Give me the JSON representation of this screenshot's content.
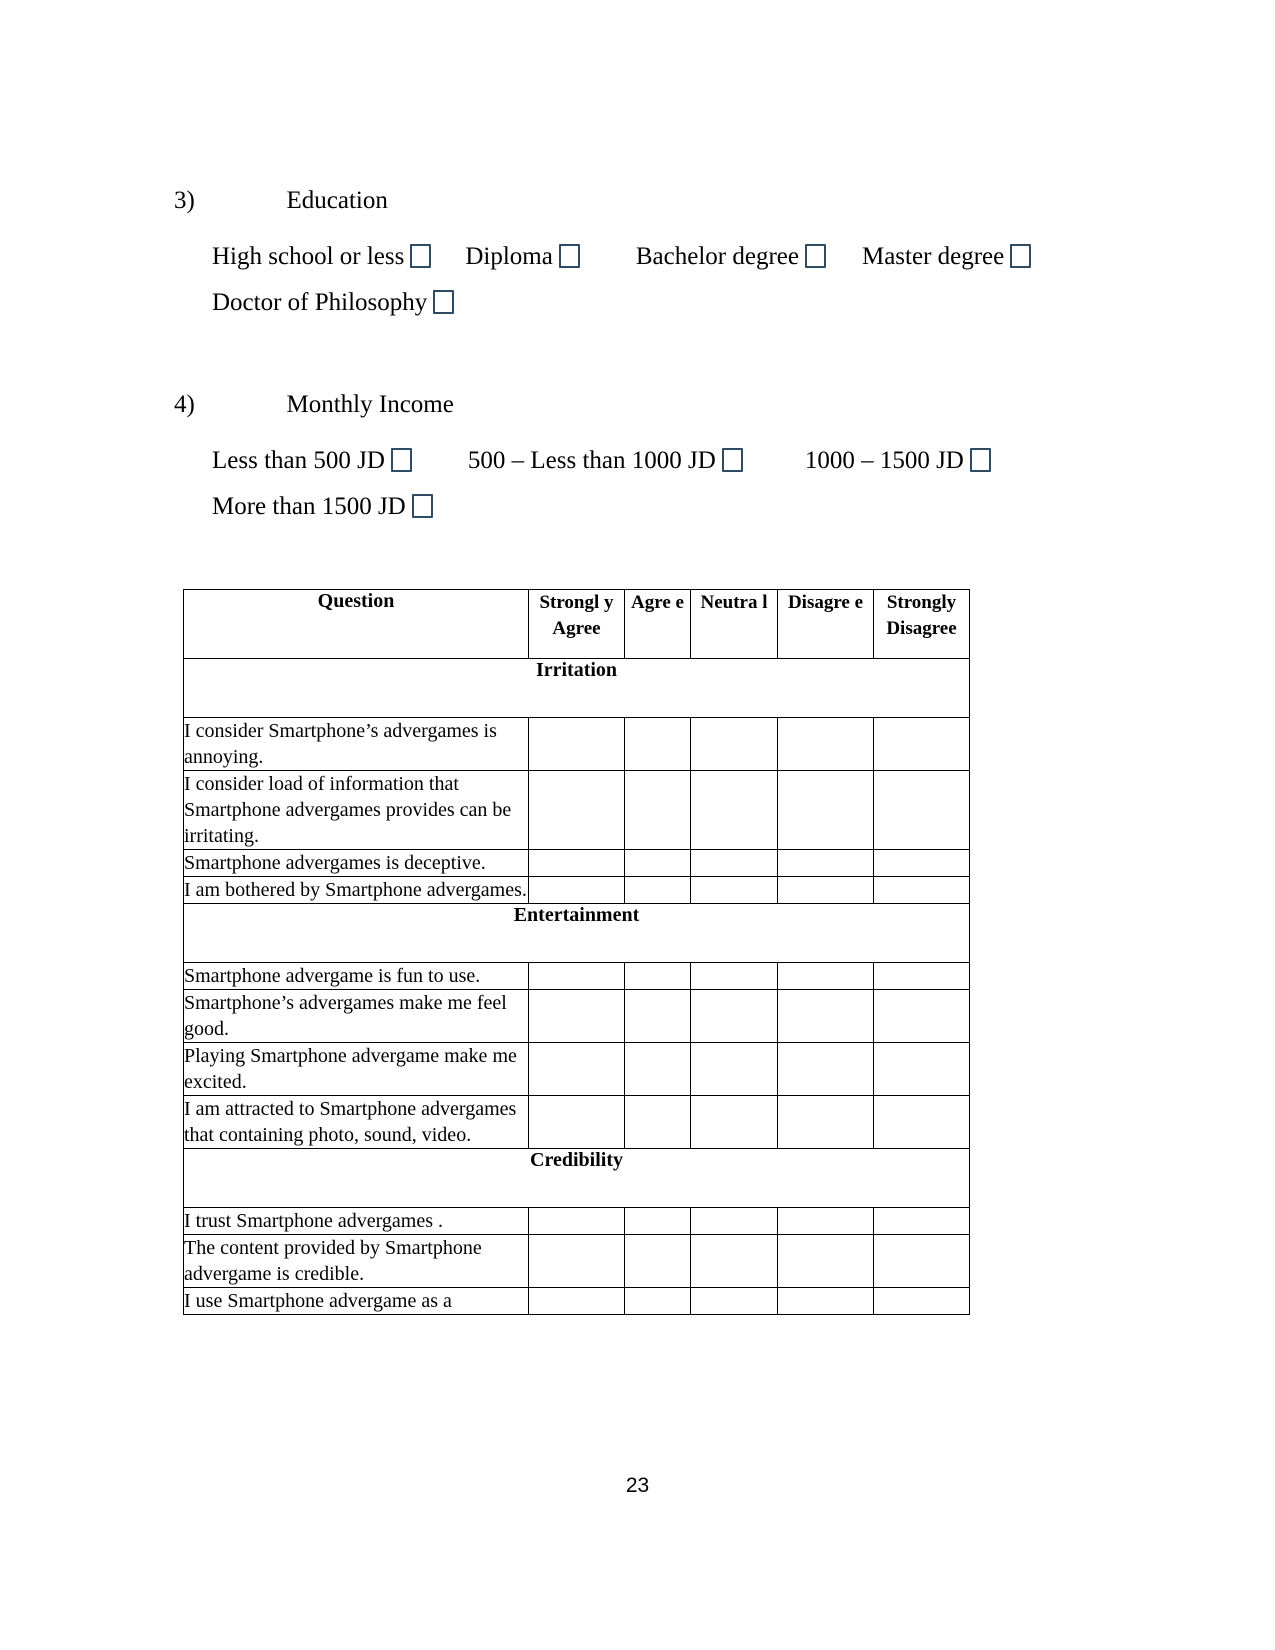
{
  "page": {
    "number": "23",
    "accent_checkbox_border": "#2d4c64"
  },
  "questions": [
    {
      "number": "3)",
      "title": "Education",
      "heading_text": "3)\t          Education",
      "rows": [
        [
          {
            "label": "High school or less",
            "checkbox": true
          },
          {
            "label": "Diploma",
            "checkbox": true
          },
          {
            "label": "Bachelor degree",
            "checkbox": true
          },
          {
            "label": "Master degree",
            "checkbox": true
          }
        ],
        [
          {
            "label": "Doctor of Philosophy",
            "checkbox": true
          }
        ]
      ]
    },
    {
      "number": "4)",
      "title": "Monthly Income",
      "heading_text": "4)\t          Monthly Income",
      "rows": [
        [
          {
            "label": "Less than 500 JD",
            "checkbox": true
          },
          {
            "label": "500 – Less than 1000 JD",
            "checkbox": true
          },
          {
            "label": "1000 – 1500 JD",
            "checkbox": true
          }
        ],
        [
          {
            "label": "More than 1500 JD",
            "checkbox": true
          }
        ]
      ]
    }
  ],
  "survey_table": {
    "headers": {
      "question": "Question",
      "strongly_agree": "Strongl y Agree",
      "agree": "Agre e",
      "neutral": "Neutra l",
      "disagree": "Disagre e",
      "strongly_disagree": "Strongly Disagree"
    },
    "sections": [
      {
        "title": "Irritation",
        "items": [
          "I consider Smartphone’s advergames is annoying.",
          "I consider load of information that Smartphone advergames provides can be irritating.",
          "Smartphone advergames is deceptive.",
          "I am bothered by Smartphone advergames."
        ]
      },
      {
        "title": "Entertainment",
        "items": [
          "Smartphone advergame is fun to use.",
          "Smartphone’s advergames make me feel good.",
          "Playing Smartphone advergame make me excited.",
          "I am attracted to Smartphone advergames that containing photo, sound, video."
        ]
      },
      {
        "title": "Credibility",
        "items": [
          "I trust Smartphone advergames .",
          "The content provided by Smartphone advergame  is credible.",
          "I use Smartphone advergame as a"
        ]
      }
    ]
  }
}
